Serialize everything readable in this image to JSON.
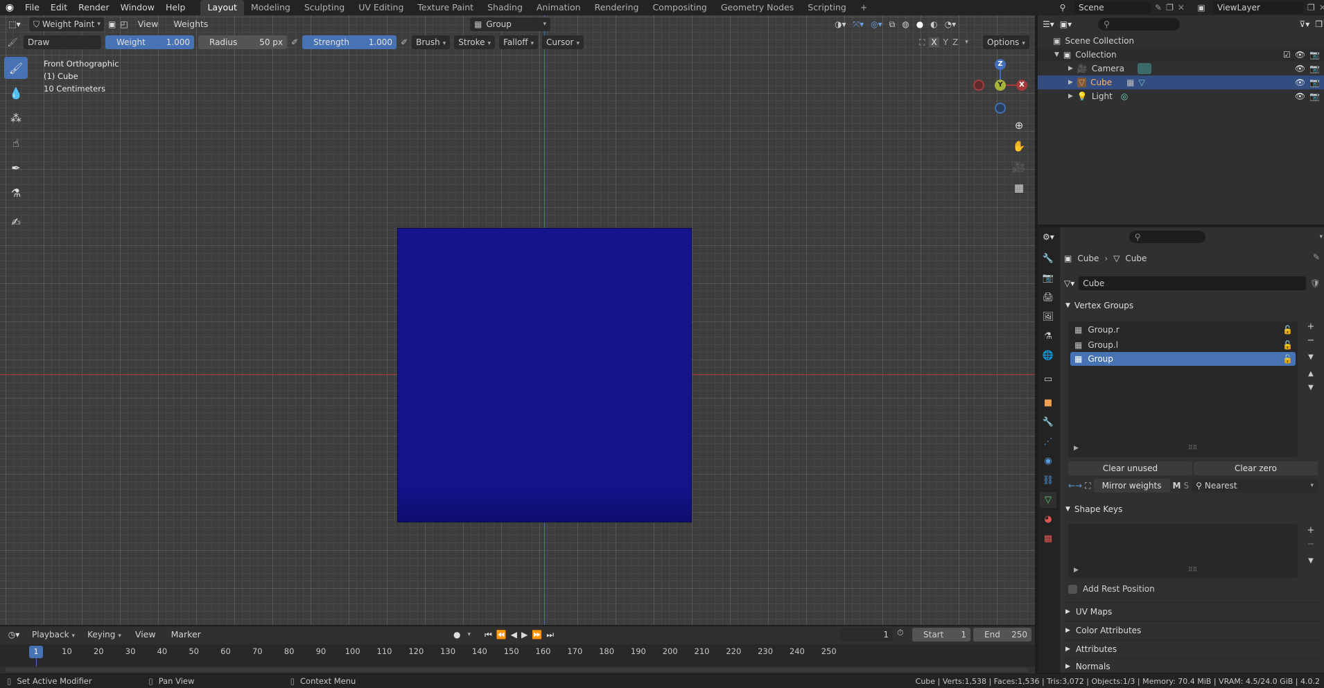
{
  "topbar": {
    "menus": [
      "File",
      "Edit",
      "Render",
      "Window",
      "Help"
    ],
    "workspaces": [
      "Layout",
      "Modeling",
      "Sculpting",
      "UV Editing",
      "Texture Paint",
      "Shading",
      "Animation",
      "Rendering",
      "Compositing",
      "Geometry Nodes",
      "Scripting"
    ],
    "active_workspace": "Layout",
    "add_tab": "+",
    "scene": "Scene",
    "view_layer": "ViewLayer"
  },
  "viewport_header": {
    "mode": "Weight Paint",
    "view": "View",
    "weights": "Weights",
    "group": "Group"
  },
  "tool_settings": {
    "brush_name": "Draw",
    "weight_label": "Weight",
    "weight_value": "1.000",
    "radius_label": "Radius",
    "radius_value": "50 px",
    "strength_label": "Strength",
    "strength_value": "1.000",
    "brush": "Brush",
    "stroke": "Stroke",
    "falloff": "Falloff",
    "cursor": "Cursor",
    "x": "X",
    "y": "Y",
    "z": "Z",
    "options": "Options"
  },
  "viewport_info": {
    "view_name": "Front Orthographic",
    "object": "(1) Cube",
    "scale": "10 Centimeters"
  },
  "gizmo": {
    "z": "Z",
    "y": "Y",
    "x": "X"
  },
  "outliner": {
    "scene_collection": "Scene Collection",
    "collection": "Collection",
    "items": [
      {
        "name": "Camera",
        "color": "#e8a070"
      },
      {
        "name": "Cube",
        "color": "#e8a070"
      },
      {
        "name": "Light",
        "color": "#e8a070"
      }
    ]
  },
  "properties": {
    "breadcrumb_object": "Cube",
    "breadcrumb_data": "Cube",
    "mesh_name": "Cube",
    "vertex_groups_title": "Vertex Groups",
    "vertex_groups": [
      "Group.r",
      "Group.l",
      "Group"
    ],
    "active_group": "Group",
    "clear_unused": "Clear unused",
    "clear_zero": "Clear zero",
    "mirror_weights": "Mirror weights",
    "m": "M",
    "s": "S",
    "nearest": "Nearest",
    "shape_keys_title": "Shape Keys",
    "add_rest_position": "Add Rest Position",
    "uv_maps": "UV Maps",
    "color_attributes": "Color Attributes",
    "attributes": "Attributes",
    "normals": "Normals"
  },
  "timeline": {
    "playback": "Playback",
    "keying": "Keying",
    "view": "View",
    "marker": "Marker",
    "current_frame": "1",
    "start_label": "Start",
    "start_value": "1",
    "end_label": "End",
    "end_value": "250",
    "frame_numbers": [
      "10",
      "20",
      "30",
      "40",
      "50",
      "60",
      "70",
      "80",
      "90",
      "100",
      "110",
      "120",
      "130",
      "140",
      "150",
      "160",
      "170",
      "180",
      "190",
      "200",
      "210",
      "220",
      "230",
      "240",
      "250"
    ],
    "playhead": "1"
  },
  "status_bar": {
    "left_action": "Set Active Modifier",
    "middle_action": "Pan View",
    "right_action": "Context Menu",
    "stats": "Cube | Verts:1,538 | Faces:1,536 | Tris:3,072 | Objects:1/3 | Memory: 70.4 MiB | VRAM: 4.5/24.0 GiB | 4.0.2"
  },
  "colors": {
    "accent": "#4772b3",
    "cube": "#13138a",
    "x_axis": "#a63a3a",
    "y_axis": "#3f6fb8"
  }
}
